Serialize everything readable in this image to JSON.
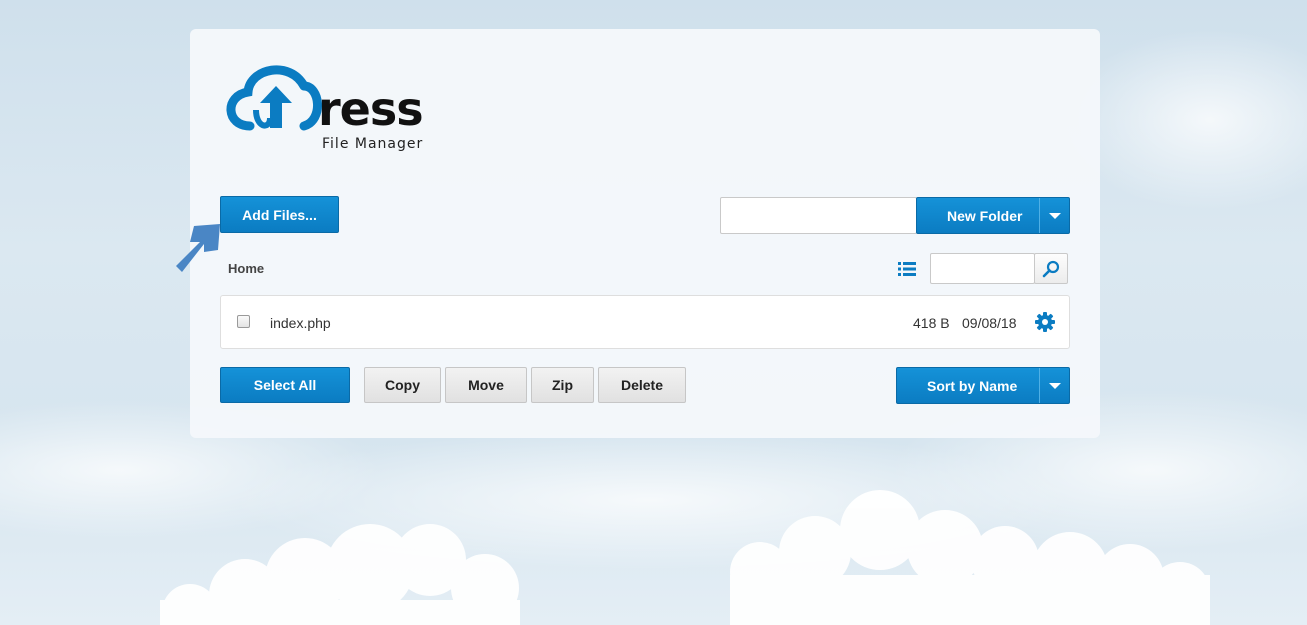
{
  "app": {
    "logo_word": "ress",
    "logo_subtitle": "File Manager"
  },
  "toolbar": {
    "add_files_label": "Add Files...",
    "new_folder_input_value": "",
    "new_folder_label": "New Folder"
  },
  "breadcrumb": {
    "current": "Home"
  },
  "search": {
    "value": ""
  },
  "files": [
    {
      "name": "index.php",
      "size": "418 B",
      "date": "09/08/18",
      "selected": false
    }
  ],
  "actions": {
    "select_all": "Select All",
    "copy": "Copy",
    "move": "Move",
    "zip": "Zip",
    "delete": "Delete",
    "sort_label": "Sort by Name"
  },
  "colors": {
    "accent": "#0b7cc2",
    "arrow": "#4a86c5"
  },
  "icons": {
    "list_view": "list-view-icon",
    "search": "search-icon",
    "file_settings": "gear-icon",
    "dropdown": "caret-down-icon",
    "pointer": "arrow-up-right-icon"
  }
}
